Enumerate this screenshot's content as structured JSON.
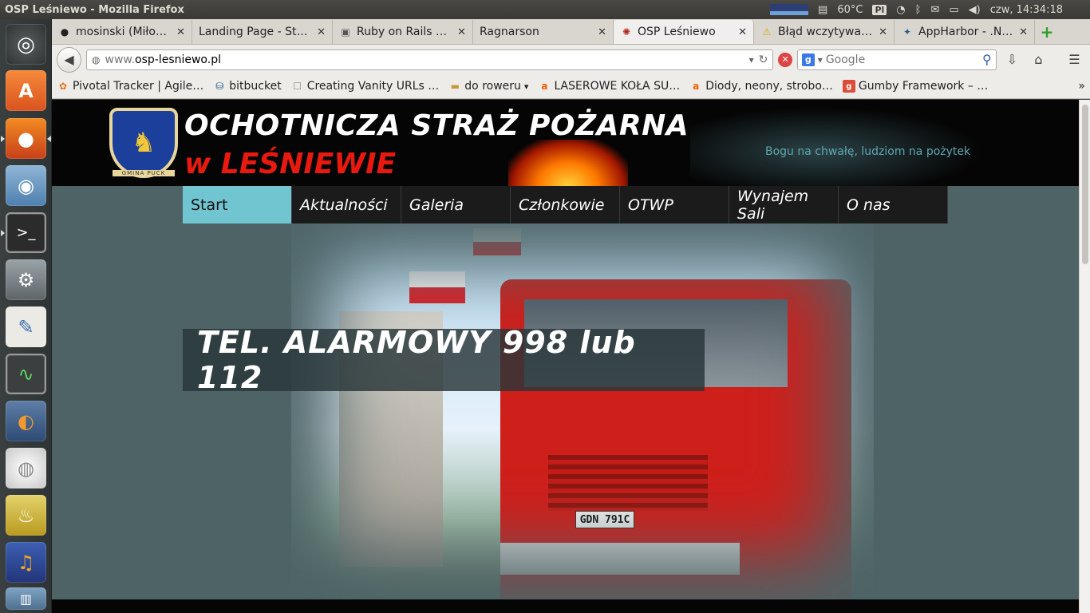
{
  "panel": {
    "title": "OSP Leśniewo - Mozilla Firefox",
    "temperature": "60°C",
    "pl_label": "Pl",
    "clock": "czw, 14:34:18"
  },
  "tabs": [
    {
      "label": "mosinski (Miło…",
      "icon": "github-icon"
    },
    {
      "label": "Landing Page - Sta…",
      "icon": "none"
    },
    {
      "label": "Ruby on Rails d…",
      "icon": "page-icon"
    },
    {
      "label": "Ragnarson",
      "icon": "none"
    },
    {
      "label": "OSP Leśniewo",
      "icon": "osp-icon",
      "active": true
    },
    {
      "label": "Błąd wczytywa…",
      "icon": "warning-icon"
    },
    {
      "label": "AppHarbor - .N…",
      "icon": "appharbor-icon"
    }
  ],
  "nav": {
    "url_prefix": "www.",
    "url_host": "osp-lesniewo.pl",
    "search_placeholder": "Google"
  },
  "bookmarks": [
    {
      "label": "Pivotal Tracker | Agile…",
      "icon": "pivotal-icon",
      "color": "#e8721b"
    },
    {
      "label": "bitbucket",
      "icon": "bitbucket-icon",
      "color": "#205081"
    },
    {
      "label": "Creating Vanity URLs …",
      "icon": "page-icon",
      "color": "#888888"
    },
    {
      "label": "do roweru",
      "icon": "folder-icon",
      "color": "#c99a3c"
    },
    {
      "label": "LASEROWE KOŁA SU…",
      "icon": "allegro-icon",
      "color": "#ff5a00"
    },
    {
      "label": "Diody, neony, strobo…",
      "icon": "allegro-icon",
      "color": "#ff5a00"
    },
    {
      "label": "Gumby Framework – …",
      "icon": "google-plus-icon",
      "color": "#dd4b39"
    }
  ],
  "site": {
    "title_line1": "OCHOTNICZA STRAŻ POŻARNA",
    "title_line2": "w LEŚNIEWIE",
    "motto": "Bogu na chwałę, ludziom na pożytek",
    "crest_text": "GMINA PUCK",
    "menu": [
      "Start",
      "Aktualności",
      "Galeria",
      "Członkowie",
      "OTWP",
      "Wynajem Sali",
      "O nas"
    ],
    "active_menu": "Start",
    "alarm": "TEL. ALARMOWY 998 lub 112",
    "plate": "GDN 791C"
  },
  "colors": {
    "accent": "#71c5d1",
    "brand_red": "#e8190f",
    "page_bg": "#4d6366"
  }
}
